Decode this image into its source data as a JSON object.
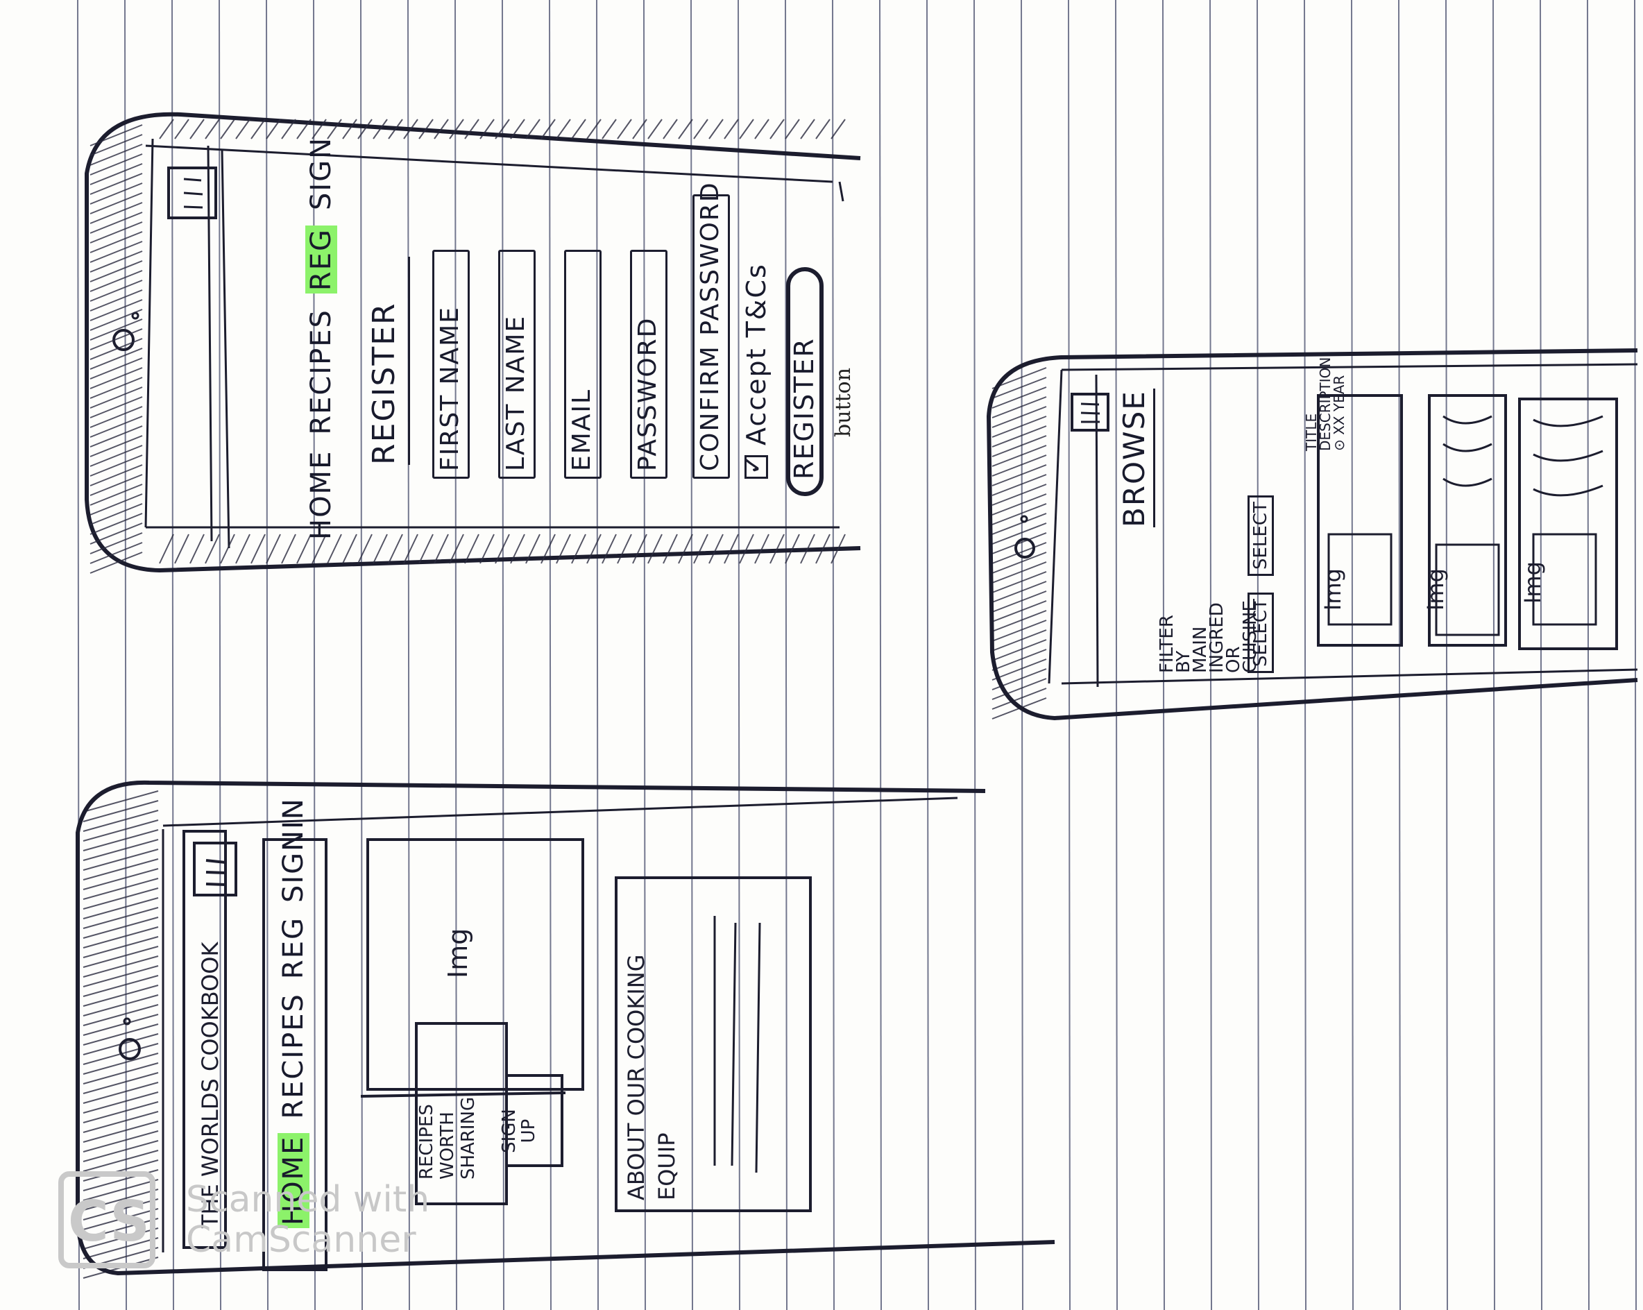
{
  "register_screen": {
    "nav": {
      "home": "HOME",
      "recipes": "RECIPES",
      "reg": "REG",
      "sign": "SIGN"
    },
    "title": "REGISTER",
    "fields": [
      "FIRST NAME",
      "LAST NAME",
      "EMAIL",
      "PASSWORD",
      "CONFIRM PASSWORD"
    ],
    "checkbox_label": "Accept T&Cs",
    "button_label": "REGISTER",
    "button_note": "button"
  },
  "home_screen": {
    "app_title": "THE WORLDS COOKBOOK",
    "nav": {
      "home": "HOME",
      "recipes": "RECIPES",
      "reg": "REG",
      "signin": "SIGNIN"
    },
    "hero_image": "Img",
    "hero_text": "RECIPES\nWORTH SHARING",
    "signup_button": "SIGN\nUP",
    "about_text": "ABOUT OUR COOKING\nEQUIP"
  },
  "browse_screen": {
    "title": "BROWSE",
    "filter_label": "FILTER\nBY\nMAIN\nINGRED\nOR CUISINE",
    "select_1": "SELECT",
    "select_2": "SELECT",
    "card_image": "Img",
    "card_text": "TITLE\nDESCRIPTION\n⊙ XX YEAR"
  },
  "watermark": {
    "logo": "CS",
    "text": "Scanned with\nCamScanner"
  }
}
